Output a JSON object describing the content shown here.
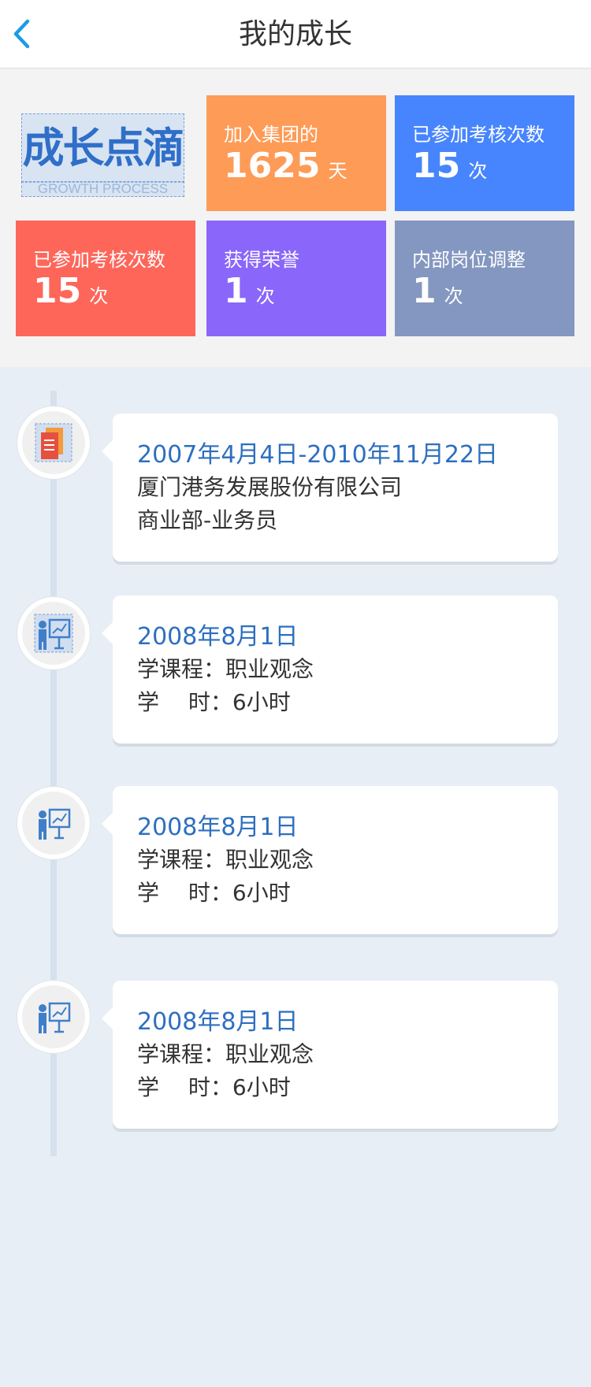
{
  "header": {
    "title": "我的成长",
    "back_icon": "chevron-left-icon"
  },
  "logo": {
    "zh": "成长点滴",
    "en": "GROWTH PROCESS"
  },
  "stats": [
    {
      "label": "加入集团的",
      "value": "1625",
      "unit": "天",
      "color": "#fe9b56"
    },
    {
      "label": "已参加考核次数",
      "value": "15",
      "unit": "次",
      "color": "#4785fe"
    },
    {
      "label": "已参加考核次数",
      "value": "15",
      "unit": "次",
      "color": "#fe665a"
    },
    {
      "label": "获得荣誉",
      "value": "1",
      "unit": "次",
      "color": "#8a66fb"
    },
    {
      "label": "内部岗位调整",
      "value": "1",
      "unit": "次",
      "color": "#8397c0"
    }
  ],
  "timeline": [
    {
      "icon": "book-icon",
      "date": "2007年4月4日-2010年11月22日",
      "line1": "厦门港务发展股份有限公司",
      "line2": "商业部-业务员"
    },
    {
      "icon": "teacher-icon",
      "date": "2008年8月1日",
      "line1": "学课程：职业观念",
      "line2": "学　 时：6小时"
    },
    {
      "icon": "teacher-icon",
      "date": "2008年8月1日",
      "line1": "学课程：职业观念",
      "line2": "学　 时：6小时"
    },
    {
      "icon": "teacher-icon",
      "date": "2008年8月1日",
      "line1": "学课程：职业观念",
      "line2": "学　 时：6小时"
    }
  ]
}
